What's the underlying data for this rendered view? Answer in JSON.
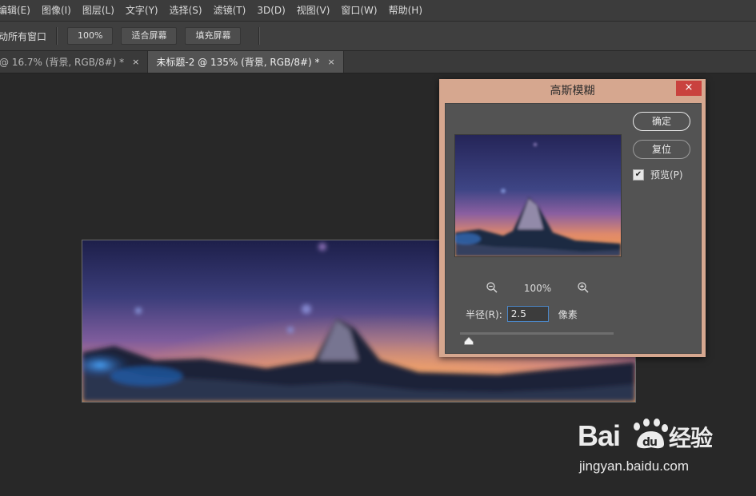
{
  "menubar": {
    "items": [
      "编辑(E)",
      "图像(I)",
      "图层(L)",
      "文字(Y)",
      "选择(S)",
      "滤镜(T)",
      "3D(D)",
      "视图(V)",
      "窗口(W)",
      "帮助(H)"
    ]
  },
  "options": {
    "label": "动所有窗口",
    "zoom_btn": "100%",
    "fit_btn": "适合屏幕",
    "fill_btn": "填充屏幕"
  },
  "tabs": [
    {
      "label": "@ 16.7% (背景, RGB/8#) *",
      "close": "×"
    },
    {
      "label": "未标题-2 @ 135% (背景, RGB/8#) *",
      "close": "×"
    }
  ],
  "dialog": {
    "title": "高斯模糊",
    "close": "×",
    "ok_label": "确定",
    "reset_label": "复位",
    "preview_label": "预览(P)",
    "preview_checked": true,
    "check_mark": "✔",
    "zoom_value": "100%",
    "radius_label": "半径(R):",
    "radius_value": "2.5",
    "radius_unit": "像素"
  },
  "watermark": {
    "logo": "Bai 经验",
    "url": "jingyan.baidu.com"
  },
  "colors": {
    "dialog_frame": "#d6a78f",
    "close_button": "#c9423e",
    "input_border": "#4c86c6"
  }
}
